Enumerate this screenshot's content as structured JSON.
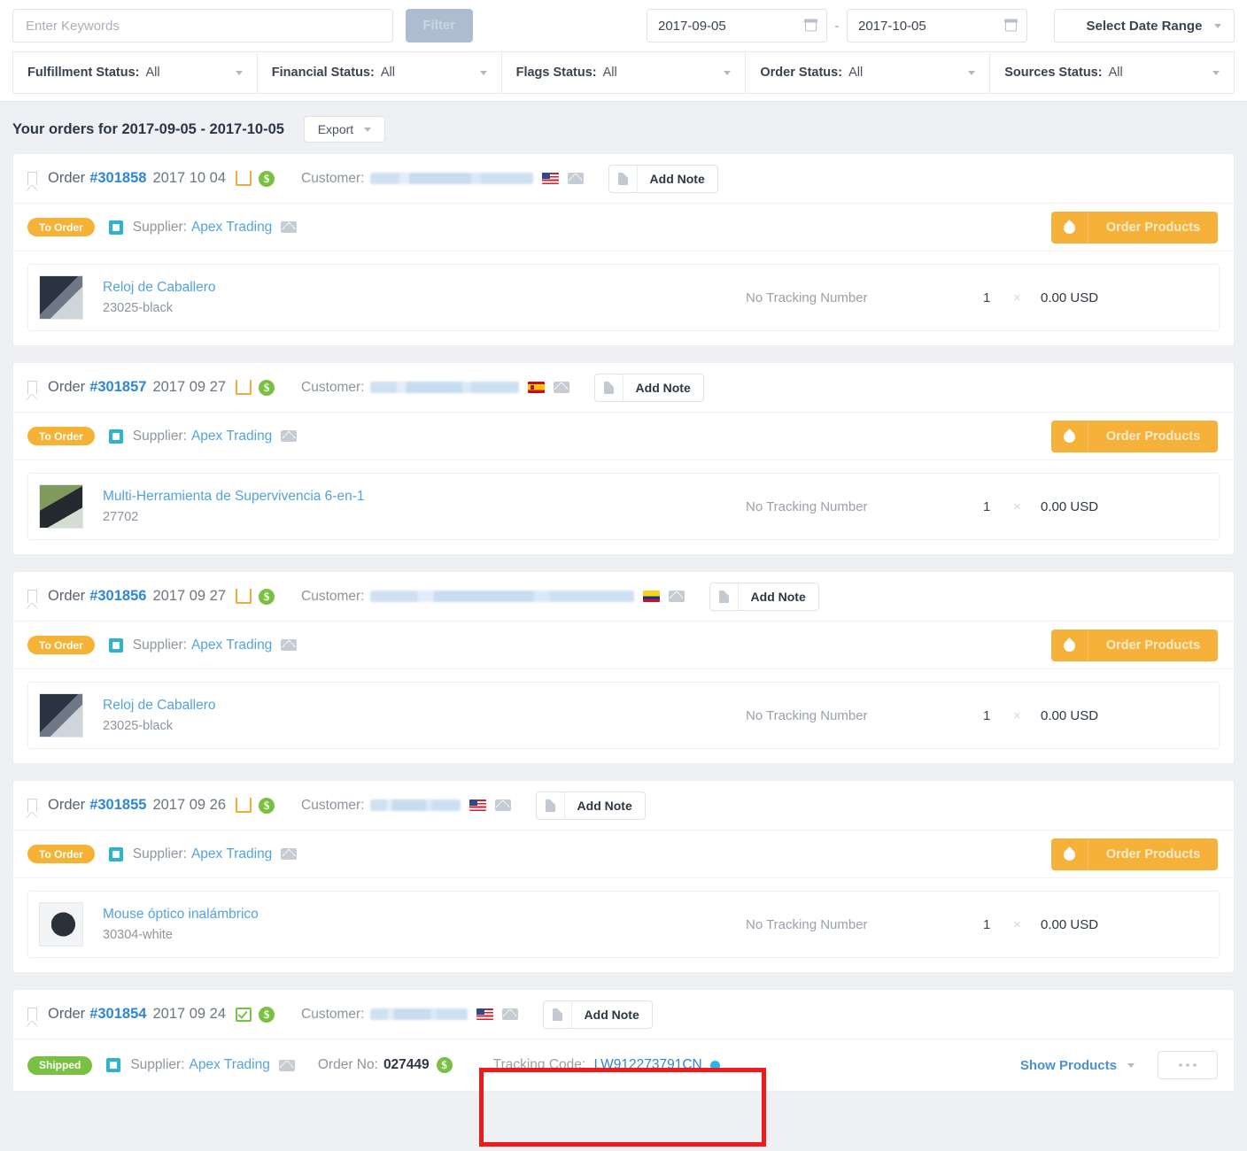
{
  "filters": {
    "keywords_placeholder": "Enter Keywords",
    "keywords_value": "",
    "filter_button": "Filter",
    "date_from": "2017-09-05",
    "date_to": "2017-10-05",
    "date_separator": "-",
    "date_range_button": "Select Date Range",
    "selects": [
      {
        "label": "Fulfillment Status:",
        "value": "All"
      },
      {
        "label": "Financial Status:",
        "value": "All"
      },
      {
        "label": "Flags Status:",
        "value": "All"
      },
      {
        "label": "Order Status:",
        "value": "All"
      },
      {
        "label": "Sources Status:",
        "value": "All"
      }
    ]
  },
  "orders_header": {
    "title": "Your orders for 2017-09-05 - 2017-10-05",
    "export_label": "Export"
  },
  "labels": {
    "order_word": "Order",
    "customer_label": "Customer:",
    "add_note": "Add Note",
    "supplier_label": "Supplier:",
    "order_no_label": "Order No:",
    "tracking_code_label": "Tracking Code:",
    "order_products": "Order Products",
    "show_products": "Show Products",
    "no_tracking": "No Tracking Number",
    "times_symbol": "×"
  },
  "colors": {
    "accent_blue": "#2f86d4",
    "link_blue": "#54a3dd",
    "orange": "#f5b13a",
    "green": "#7ac143",
    "teal": "#2bb3cf",
    "highlight_red": "#ec1c1c",
    "page_bg": "#eef0f3"
  },
  "orders": [
    {
      "number": "#301858",
      "date": "2017 10 04",
      "fulfillment_icon": "open-box-icon",
      "financial_icon": "dollar-paid-icon",
      "flag": "us",
      "status_badge": "To Order",
      "status_type": "toorder",
      "supplier": "Apex Trading",
      "product": {
        "name": "Reloj de Caballero",
        "sku": "23025-black",
        "thumb": "watch",
        "tracking": "No Tracking Number",
        "qty": "1",
        "price": "0.00 USD"
      }
    },
    {
      "number": "#301857",
      "date": "2017 09 27",
      "fulfillment_icon": "open-box-icon",
      "financial_icon": "dollar-paid-icon",
      "flag": "es",
      "status_badge": "To Order",
      "status_type": "toorder",
      "supplier": "Apex Trading",
      "product": {
        "name": "Multi-Herramienta de Supervivencia 6-en-1",
        "sku": "27702",
        "thumb": "tool",
        "tracking": "No Tracking Number",
        "qty": "1",
        "price": "0.00 USD"
      }
    },
    {
      "number": "#301856",
      "date": "2017 09 27",
      "fulfillment_icon": "open-box-icon",
      "financial_icon": "dollar-paid-icon",
      "flag": "co",
      "status_badge": "To Order",
      "status_type": "toorder",
      "supplier": "Apex Trading",
      "product": {
        "name": "Reloj de Caballero",
        "sku": "23025-black",
        "thumb": "watch",
        "tracking": "No Tracking Number",
        "qty": "1",
        "price": "0.00 USD"
      }
    },
    {
      "number": "#301855",
      "date": "2017 09 26",
      "fulfillment_icon": "open-box-icon",
      "financial_icon": "dollar-paid-icon",
      "flag": "us",
      "status_badge": "To Order",
      "status_type": "toorder",
      "supplier": "Apex Trading",
      "product": {
        "name": "Mouse óptico inalámbrico",
        "sku": "30304-white",
        "thumb": "mouse",
        "tracking": "No Tracking Number",
        "qty": "1",
        "price": "0.00 USD"
      }
    },
    {
      "number": "#301854",
      "date": "2017 09 24",
      "fulfillment_icon": "checked-box-icon",
      "financial_icon": "dollar-paid-icon",
      "flag": "us",
      "status_badge": "Shipped",
      "status_type": "shipped",
      "supplier": "Apex Trading",
      "supplier_order_no": "027449",
      "tracking_code": "LW912273791CN"
    }
  ]
}
